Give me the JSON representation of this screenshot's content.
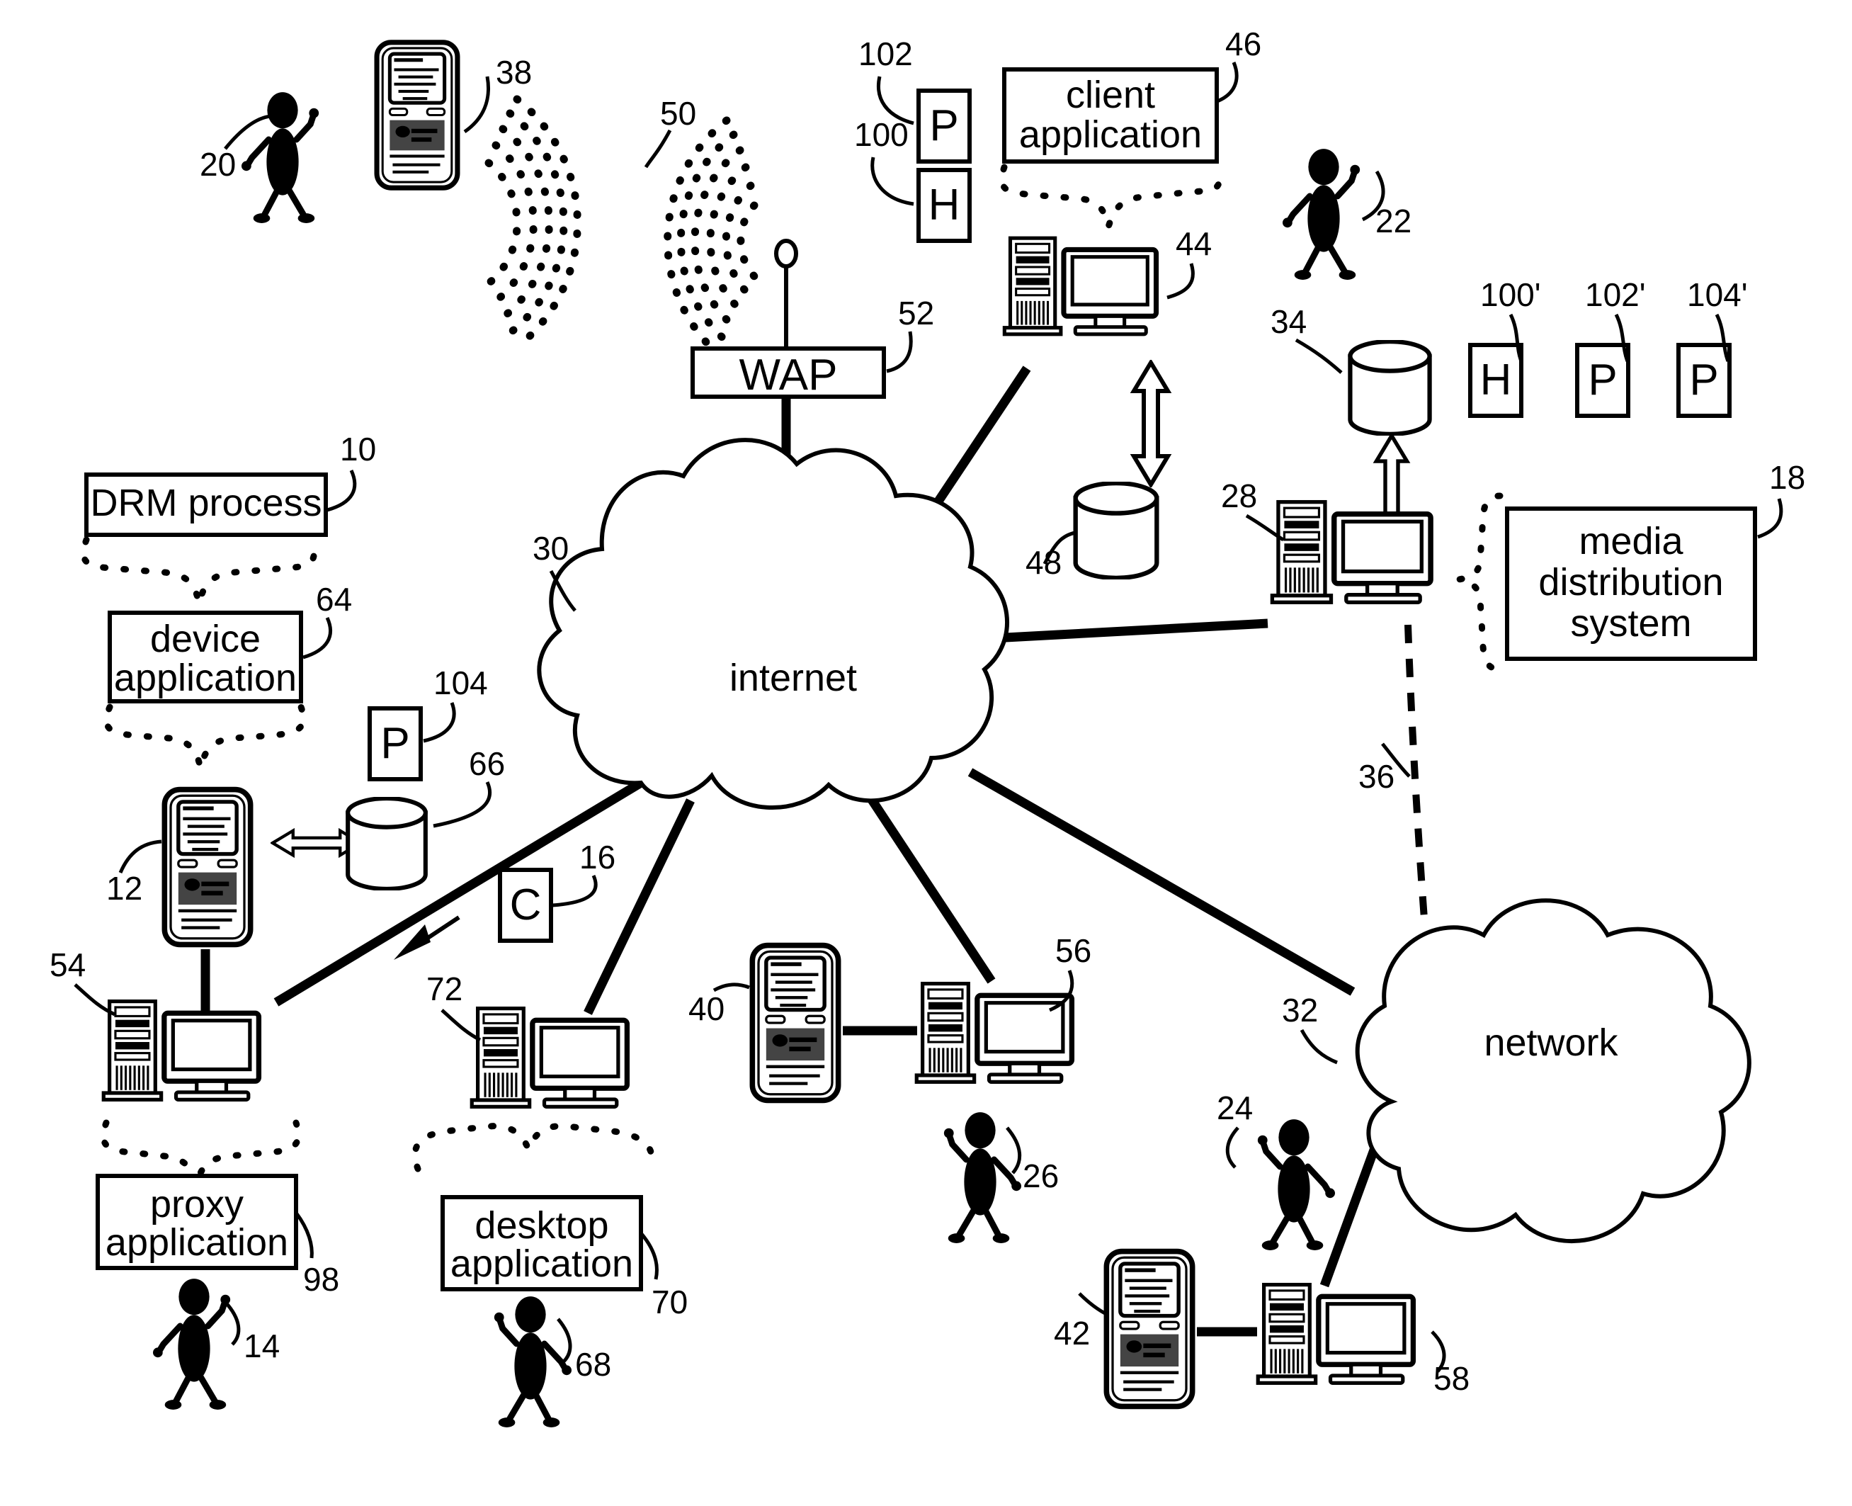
{
  "figure": {
    "type": "patent-network-diagram",
    "background": "#ffffff",
    "stroke": "#000000"
  },
  "boxes": {
    "drm_process": "DRM process",
    "device_application": "device application",
    "client_application": "client application",
    "media_distribution_system": "media distribution system",
    "proxy_application": "proxy application",
    "desktop_application": "desktop application",
    "wap": "WAP"
  },
  "clouds": {
    "internet": "internet",
    "network": "network"
  },
  "glyph_boxes": [
    {
      "label": "P",
      "ref": "102"
    },
    {
      "label": "H",
      "ref": "100"
    },
    {
      "label": "H",
      "ref": "100'"
    },
    {
      "label": "P",
      "ref": "102'"
    },
    {
      "label": "P",
      "ref": "104'"
    },
    {
      "label": "P",
      "ref": "104"
    },
    {
      "label": "C",
      "ref": "16"
    }
  ],
  "reference_numerals": [
    {
      "id": "20",
      "text": "20",
      "target": "user-stick-figure-top-left"
    },
    {
      "id": "38",
      "text": "38",
      "target": "handheld-device-top-left"
    },
    {
      "id": "50",
      "text": "50",
      "target": "wireless-signal-waves"
    },
    {
      "id": "52",
      "text": "52",
      "target": "wap-box"
    },
    {
      "id": "102",
      "text": "102",
      "target": "glyph-box-p-top"
    },
    {
      "id": "100",
      "text": "100",
      "target": "glyph-box-h-top"
    },
    {
      "id": "46",
      "text": "46",
      "target": "client-application-box"
    },
    {
      "id": "44",
      "text": "44",
      "target": "server-computer-44"
    },
    {
      "id": "48",
      "text": "48",
      "target": "database-48"
    },
    {
      "id": "22",
      "text": "22",
      "target": "user-stick-figure-22"
    },
    {
      "id": "34",
      "text": "34",
      "target": "database-34"
    },
    {
      "id": "100p",
      "text": "100'",
      "target": "glyph-box-h-right"
    },
    {
      "id": "102p",
      "text": "102'",
      "target": "glyph-box-p-right-1"
    },
    {
      "id": "104p",
      "text": "104'",
      "target": "glyph-box-p-right-2"
    },
    {
      "id": "28",
      "text": "28",
      "target": "server-computer-28"
    },
    {
      "id": "18",
      "text": "18",
      "target": "media-distribution-system-box"
    },
    {
      "id": "36",
      "text": "36",
      "target": "dashed-link-36"
    },
    {
      "id": "10",
      "text": "10",
      "target": "drm-process-box"
    },
    {
      "id": "64",
      "text": "64",
      "target": "device-application-box"
    },
    {
      "id": "104",
      "text": "104",
      "target": "glyph-box-p-left"
    },
    {
      "id": "66",
      "text": "66",
      "target": "database-66"
    },
    {
      "id": "12",
      "text": "12",
      "target": "handheld-device-12"
    },
    {
      "id": "30",
      "text": "30",
      "target": "internet-cloud"
    },
    {
      "id": "16",
      "text": "16",
      "target": "glyph-box-c"
    },
    {
      "id": "54",
      "text": "54",
      "target": "computer-54"
    },
    {
      "id": "72",
      "text": "72",
      "target": "computer-72"
    },
    {
      "id": "40",
      "text": "40",
      "target": "handheld-device-40"
    },
    {
      "id": "56",
      "text": "56",
      "target": "computer-56"
    },
    {
      "id": "98",
      "text": "98",
      "target": "proxy-application-box"
    },
    {
      "id": "70",
      "text": "70",
      "target": "desktop-application-box"
    },
    {
      "id": "14",
      "text": "14",
      "target": "user-stick-figure-14"
    },
    {
      "id": "68",
      "text": "68",
      "target": "user-stick-figure-68"
    },
    {
      "id": "26",
      "text": "26",
      "target": "user-stick-figure-26"
    },
    {
      "id": "24",
      "text": "24",
      "target": "user-stick-figure-24"
    },
    {
      "id": "32",
      "text": "32",
      "target": "network-cloud"
    },
    {
      "id": "42",
      "text": "42",
      "target": "handheld-device-42"
    },
    {
      "id": "58",
      "text": "58",
      "target": "computer-58"
    }
  ]
}
